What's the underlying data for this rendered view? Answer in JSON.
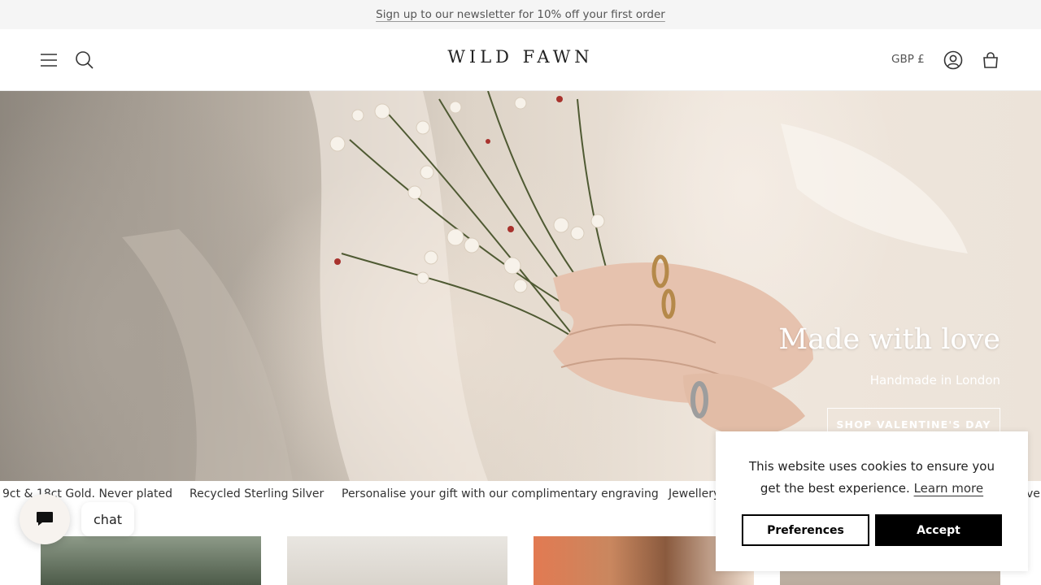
{
  "announcement": {
    "text": "Sign up to our newsletter for 10% off your first order"
  },
  "header": {
    "logo": "WILD FAWN",
    "currency": "GBP £",
    "icons": [
      "menu-icon",
      "search-icon",
      "account-icon",
      "cart-icon"
    ]
  },
  "hero": {
    "title": "Made with love",
    "subtitle": "Handmade in London",
    "cta": "SHOP VALENTINE'S DAY"
  },
  "ticker": {
    "items": [
      "9ct & 18ct Gold. Never plated",
      "Recycled Sterling Silver",
      "Personalise your gift with our complimentary engraving",
      "Jewellery",
      "ver"
    ]
  },
  "chat": {
    "label": "chat"
  },
  "cookie": {
    "message": "This website uses cookies to ensure you get the best experience.",
    "learn_more": "Learn more",
    "preferences": "Preferences",
    "accept": "Accept"
  },
  "colors": {
    "announce_bg": "#f5f5f5",
    "accept_bg": "#000000",
    "hero_text": "#ffffff"
  }
}
